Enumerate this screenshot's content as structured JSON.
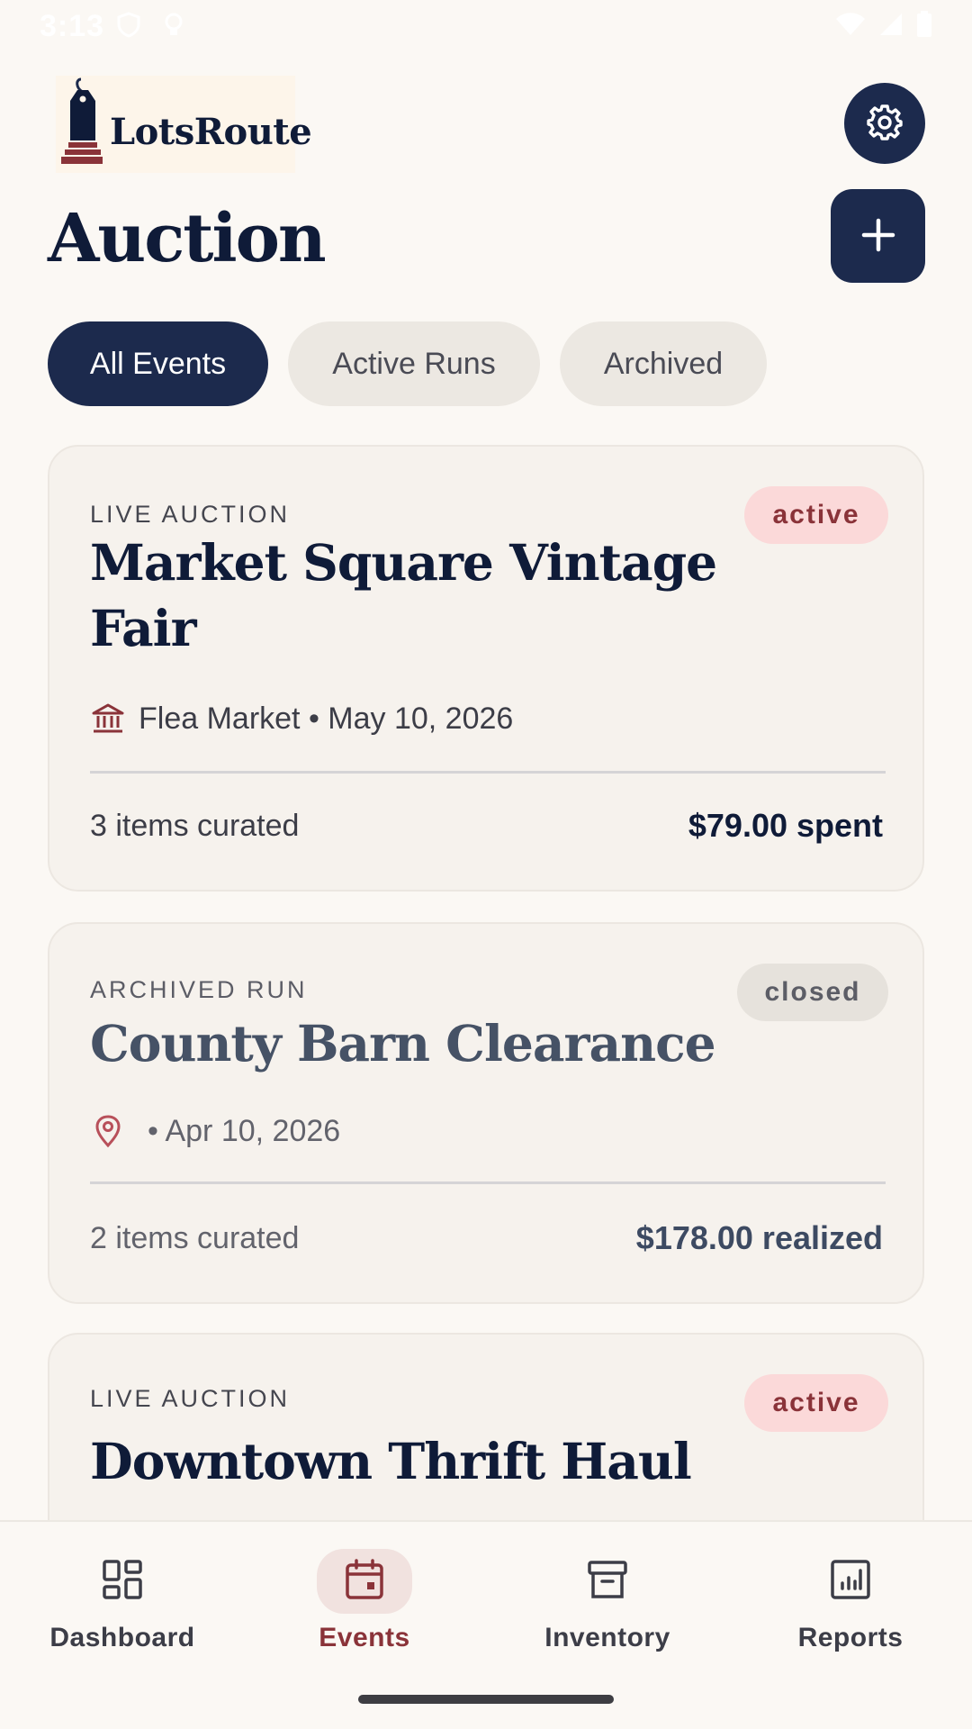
{
  "status_bar": {
    "time": "3:13"
  },
  "header": {
    "logo_text": "LotsRoute",
    "page_title": "Auction",
    "settings_icon": "gear-icon",
    "add_icon": "plus-icon"
  },
  "tabs": [
    {
      "label": "All Events",
      "selected": true
    },
    {
      "label": "Active Runs",
      "selected": false
    },
    {
      "label": "Archived",
      "selected": false
    }
  ],
  "events": [
    {
      "kicker": "LIVE AUCTION",
      "status": "active",
      "title_line1": "Market Square Vintage",
      "title_line2": "Fair",
      "icon": "building-icon",
      "meta": "Flea Market • May 10, 2026",
      "items": "3 items curated",
      "amount": "$79.00 spent"
    },
    {
      "kicker": "ARCHIVED RUN",
      "status": "closed",
      "title": "County Barn Clearance",
      "icon": "location-pin-icon",
      "meta": "• Apr 10, 2026",
      "items": "2 items curated",
      "amount": "$178.00 realized"
    },
    {
      "kicker": "LIVE AUCTION",
      "status": "active",
      "title": "Downtown Thrift Haul"
    }
  ],
  "bottom_nav": [
    {
      "label": "Dashboard",
      "icon": "dashboard-icon",
      "selected": false
    },
    {
      "label": "Events",
      "icon": "calendar-icon",
      "selected": true
    },
    {
      "label": "Inventory",
      "icon": "archive-box-icon",
      "selected": false
    },
    {
      "label": "Reports",
      "icon": "bar-chart-icon",
      "selected": false
    }
  ],
  "colors": {
    "background": "#fbf8f4",
    "primary": "#1c2a4d",
    "accent": "#8a3339",
    "active_badge": "#fbd9d9",
    "closed_badge": "#e6e2dc"
  }
}
